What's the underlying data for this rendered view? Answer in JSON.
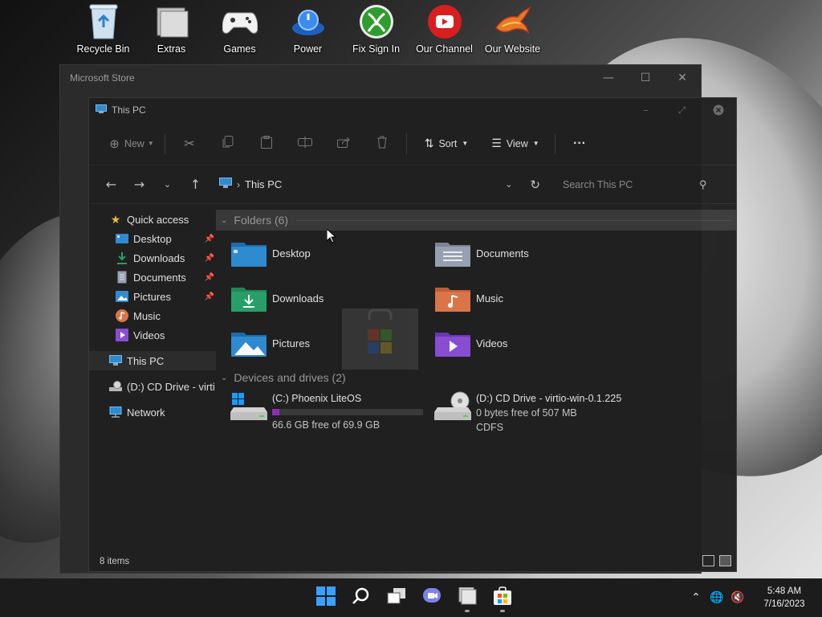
{
  "desktop": {
    "icons": [
      {
        "label": "Recycle Bin",
        "icon": "recycle-bin-icon"
      },
      {
        "label": "Extras",
        "icon": "folder-icon"
      },
      {
        "label": "Games",
        "icon": "gamepad-icon"
      },
      {
        "label": "Power",
        "icon": "power-icon"
      },
      {
        "label": "Fix Sign In",
        "icon": "xbox-icon"
      },
      {
        "label": "Our Channel",
        "icon": "youtube-icon"
      },
      {
        "label": "Our Website",
        "icon": "phoenix-icon"
      }
    ]
  },
  "store_window": {
    "title": "Microsoft Store",
    "minimize": "—",
    "maximize": "☐",
    "close": "✕"
  },
  "explorer": {
    "title": "This PC",
    "controls": {
      "minimize": "–",
      "maximize": "⤢",
      "close": "✕"
    },
    "toolbar": {
      "new_label": "New",
      "sort_label": "Sort",
      "view_label": "View",
      "more_label": "···"
    },
    "address": {
      "location": "This PC",
      "search_placeholder": "Search This PC"
    },
    "nav": {
      "quick_access": "Quick access",
      "items": [
        {
          "label": "Desktop",
          "icon": "desktop-icon",
          "color": "#2f8fd6",
          "pinned": true
        },
        {
          "label": "Downloads",
          "icon": "downloads-icon",
          "color": "#28a36a",
          "pinned": true
        },
        {
          "label": "Documents",
          "icon": "documents-icon",
          "color": "#9aa4b5",
          "pinned": true
        },
        {
          "label": "Pictures",
          "icon": "pictures-icon",
          "color": "#2f8fd6",
          "pinned": true
        },
        {
          "label": "Music",
          "icon": "music-icon",
          "color": "#e0784c",
          "pinned": false
        },
        {
          "label": "Videos",
          "icon": "videos-icon",
          "color": "#8a4fd8",
          "pinned": false
        }
      ],
      "this_pc": "This PC",
      "cd_drive": "(D:) CD Drive - virti",
      "network": "Network"
    },
    "folders_header": "Folders (6)",
    "folders": [
      {
        "label": "Desktop",
        "icon": "desktop-folder-icon",
        "color": "#2f8fd6"
      },
      {
        "label": "Documents",
        "icon": "documents-folder-icon",
        "color": "#9aa4b5"
      },
      {
        "label": "Downloads",
        "icon": "downloads-folder-icon",
        "color": "#28a36a"
      },
      {
        "label": "Music",
        "icon": "music-folder-icon",
        "color": "#e0784c"
      },
      {
        "label": "Pictures",
        "icon": "pictures-folder-icon",
        "color": "#2f8fd6"
      },
      {
        "label": "Videos",
        "icon": "videos-folder-icon",
        "color": "#8a4fd8"
      }
    ],
    "drives_header": "Devices and drives (2)",
    "drives": [
      {
        "name": "(C:) Phoenix LiteOS",
        "free": "66.6 GB free of 69.9 GB",
        "used_fraction": 0.05,
        "icon": "windows-drive-icon"
      },
      {
        "name": "(D:) CD Drive - virtio-win-0.1.225",
        "free": "0 bytes free of 507 MB",
        "fs": "CDFS",
        "icon": "cd-drive-icon"
      }
    ],
    "status": {
      "items": "8 items"
    }
  },
  "taskbar": {
    "time": "5:48 AM",
    "date": "7/16/2023",
    "buttons": [
      "start-icon",
      "search-icon",
      "task-view-icon",
      "chat-icon",
      "file-explorer-icon",
      "store-icon"
    ]
  }
}
